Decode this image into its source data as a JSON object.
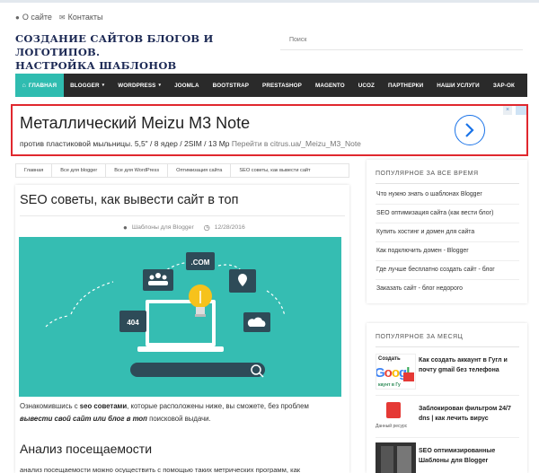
{
  "toplinks": {
    "about": "О сайте",
    "contacts": "Контакты"
  },
  "site": {
    "title_line1": "СОЗДАНИЕ САЙТОВ БЛОГОВ И ЛОГОТИПОВ.",
    "title_line2": "НАСТРОЙКА ШАБЛОНОВ"
  },
  "search": {
    "placeholder": "Поиск"
  },
  "nav": {
    "items": [
      {
        "label": "ГЛАВНАЯ",
        "active": true
      },
      {
        "label": "BLOGGER",
        "dropdown": true
      },
      {
        "label": "WORDPRESS",
        "dropdown": true
      },
      {
        "label": "JOOMLA"
      },
      {
        "label": "BOOTSTRAP"
      },
      {
        "label": "PRESTASHOP"
      },
      {
        "label": "MAGENTO"
      },
      {
        "label": "UCOZ"
      },
      {
        "label": "ПАРТНЕРКИ"
      },
      {
        "label": "НАШИ УСЛУГИ"
      },
      {
        "label": "ЗАР-ОК"
      }
    ],
    "home_icon": "home-icon"
  },
  "ad": {
    "title": "Металлический Meizu M3 Note",
    "desc": "против пластиковой мыльницы. 5,5\" / 8 ядер / 2SIM / 13 Мр",
    "url": "Перейти в citrus.ua/_Meizu_M3_Note",
    "accent": "#e0282e",
    "arrow_color": "#1a73e8"
  },
  "breadcrumb": [
    "Главная",
    "Все для blogger",
    "Все для WordPress",
    "Оптимизация сайта",
    "SEO советы, как вывести сайт"
  ],
  "post": {
    "title": "SEO советы, как вывести сайт в топ",
    "author": "Шаблоны для Blogger",
    "date": "12/28/2016",
    "hero_labels": {
      "com": ".COM",
      "e404": "404"
    },
    "hero_bg": "#35bdb2",
    "p1_a": "Ознакомившись с ",
    "p1_b": "seo советами",
    "p1_c": ", которые расположены ниже, вы сможете, без проблем",
    "p1_d": "вывести свой сайт или блог в топ",
    "p1_e": " поисковой выдачи.",
    "h2": "Анализ посещаемости",
    "p2": "анализ посещаемости можно осуществить с помощью таких метрических программ, как"
  },
  "sidebar": {
    "popular_all": {
      "title": "ПОПУЛЯРНОЕ ЗА ВСЕ ВРЕМЯ",
      "items": [
        "Что нужно знать о шаблонах Blogger",
        "SEO оптимизация сайта (как вести блог)",
        "Купить хостинг и домен для сайта",
        "Как подключить домен - Blogger",
        "Где лучше бесплатно создать сайт - блог",
        "Заказать сайт - блог недорого"
      ]
    },
    "popular_month": {
      "title": "ПОПУЛЯРНОЕ ЗА МЕСЯЦ",
      "items": [
        {
          "title": "Как создать аккаунт в Гугл и почту gmail без телефона",
          "thumb_text": "Создать",
          "thumb_sub": "каунт в Гу"
        },
        {
          "title": "Заблокирован фильтром 24/7 dns | как лечить вирус",
          "thumb_text": "Данный ресурс"
        },
        {
          "title": "SEO оптимизированные Шаблоны для Blogger"
        }
      ]
    }
  }
}
